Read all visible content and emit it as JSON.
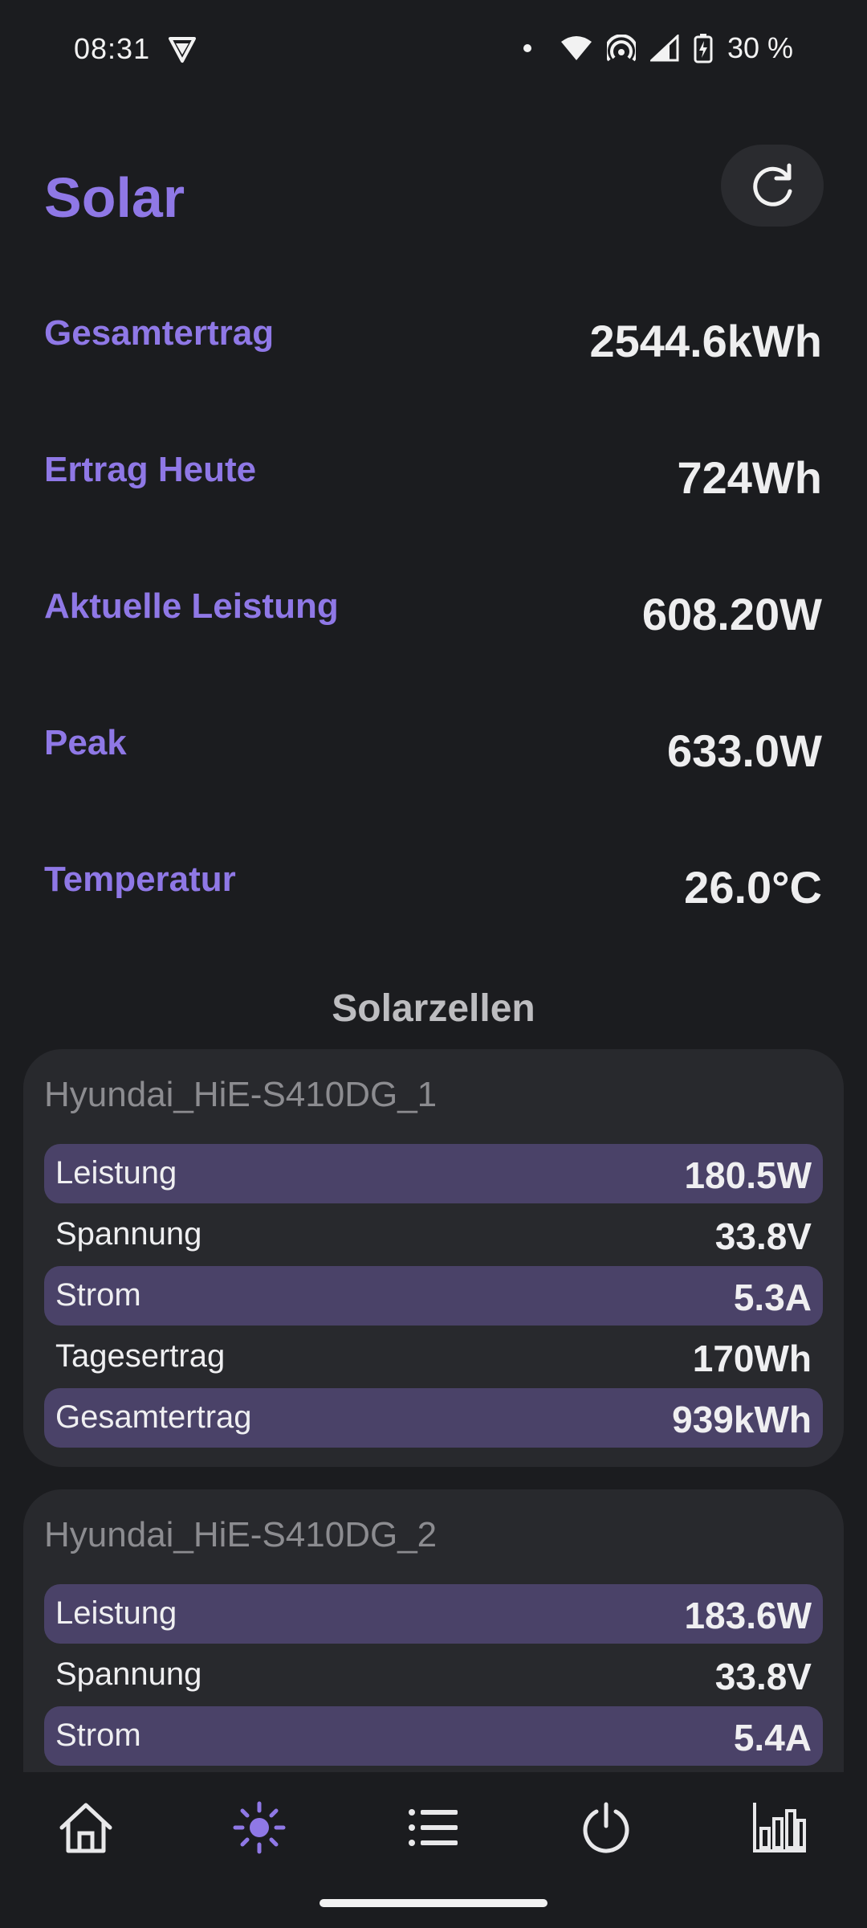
{
  "status_bar": {
    "time": "08:31",
    "battery": "30 %"
  },
  "header": {
    "title": "Solar",
    "refresh_icon": "refresh-icon"
  },
  "stats": [
    {
      "label": "Gesamtertrag",
      "value": "2544.6kWh"
    },
    {
      "label": "Ertrag Heute",
      "value": "724Wh"
    },
    {
      "label": "Aktuelle Leistung",
      "value": "608.20W"
    },
    {
      "label": "Peak",
      "value": "633.0W"
    },
    {
      "label": "Temperatur",
      "value": "26.0°C"
    }
  ],
  "section_title": "Solarzellen",
  "panels": [
    {
      "title": "Hyundai_HiE-S410DG_1",
      "rows": [
        {
          "label": "Leistung",
          "value": "180.5W"
        },
        {
          "label": "Spannung",
          "value": "33.8V"
        },
        {
          "label": "Strom",
          "value": "5.3A"
        },
        {
          "label": "Tagesertrag",
          "value": "170Wh"
        },
        {
          "label": "Gesamtertrag",
          "value": "939kWh"
        }
      ]
    },
    {
      "title": "Hyundai_HiE-S410DG_2",
      "rows": [
        {
          "label": "Leistung",
          "value": "183.6W"
        },
        {
          "label": "Spannung",
          "value": "33.8V"
        },
        {
          "label": "Strom",
          "value": "5.4A"
        }
      ]
    }
  ],
  "nav": {
    "items": [
      "home-icon",
      "sun-icon",
      "list-icon",
      "power-icon",
      "bar-chart-icon"
    ],
    "active_color": "#8f78e6",
    "inactive_color": "#e8e8ea"
  },
  "colors": {
    "accent": "#8f78e6",
    "background": "#1b1c1f",
    "panel": "#28292d",
    "row_highlight": "#4a4268"
  }
}
